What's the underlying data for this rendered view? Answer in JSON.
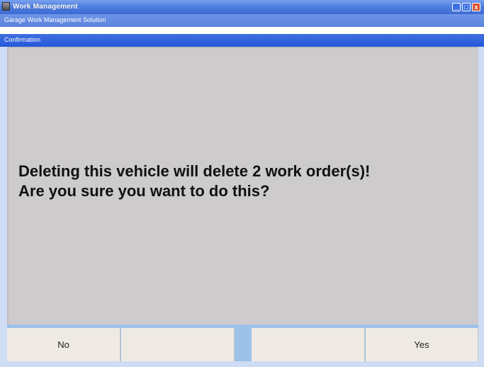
{
  "window": {
    "title": "Work Management",
    "subtitle": "Garage Work Management Solution",
    "controls": {
      "minimize": "_",
      "maximize": "□",
      "close": "x"
    },
    "colors": {
      "titlebar": "#4f7fe0",
      "close": "#d9512c"
    }
  },
  "dialog": {
    "header": "Confirmation",
    "message_line1": "Deleting this vehicle will delete 2 work order(s)!",
    "message_line2": "Are you sure you want to do this?",
    "background": "#cdcbcc"
  },
  "footer": {
    "buttons": [
      {
        "label": "No"
      },
      {
        "label": ""
      },
      {
        "label": ""
      },
      {
        "label": "Yes"
      }
    ]
  }
}
